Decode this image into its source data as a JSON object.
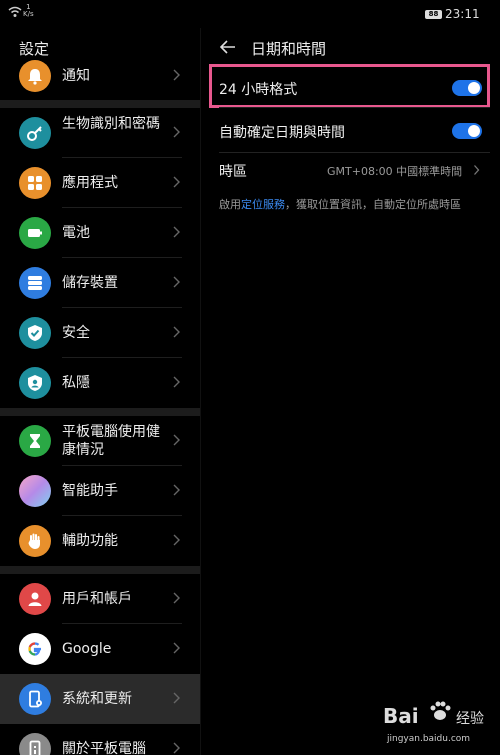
{
  "status_bar": {
    "speed_value": "1",
    "speed_unit": "K/s",
    "battery": "88",
    "time": "23:11"
  },
  "sidebar": {
    "title": "設定",
    "items": [
      {
        "label": "通知",
        "icon": "bell-icon",
        "color": "#e8902c"
      },
      {
        "label": "生物識別和密碼",
        "icon": "key-icon",
        "color": "#1e8f9e"
      },
      {
        "label": "應用程式",
        "icon": "apps-grid-icon",
        "color": "#e8902c"
      },
      {
        "label": "電池",
        "icon": "battery-icon",
        "color": "#2aa845"
      },
      {
        "label": "儲存裝置",
        "icon": "storage-icon",
        "color": "#2f7de0"
      },
      {
        "label": "安全",
        "icon": "shield-check-icon",
        "color": "#1e8f9e"
      },
      {
        "label": "私隱",
        "icon": "privacy-shield-icon",
        "color": "#1e8f9e"
      },
      {
        "label": "平板電腦使用健康情況",
        "icon": "hourglass-icon",
        "color": "#2aa845"
      },
      {
        "label": "智能助手",
        "icon": "assistant-orb-icon",
        "color": "#c48be0"
      },
      {
        "label": "輔助功能",
        "icon": "hand-icon",
        "color": "#e8902c"
      },
      {
        "label": "用戶和帳戶",
        "icon": "user-icon",
        "color": "#e04848"
      },
      {
        "label": "Google",
        "icon": "google-icon",
        "color": "#ffffff"
      },
      {
        "label": "系統和更新",
        "icon": "tablet-settings-icon",
        "color": "#2f7de0"
      },
      {
        "label": "關於平板電腦",
        "icon": "tablet-icon",
        "color": "#8a8a8a"
      }
    ]
  },
  "detail": {
    "title": "日期和時間",
    "hour24": {
      "label": "24 小時格式",
      "enabled": true
    },
    "auto": {
      "label": "自動確定日期與時間",
      "enabled": true
    },
    "timezone": {
      "label": "時區",
      "value": "GMT+08:00 中國標準時間"
    },
    "note_prefix": "啟用",
    "note_link": "定位服務",
    "note_suffix": "，獲取位置資訊，自動定位所處時區"
  },
  "watermark": {
    "brand": "Bai",
    "brand_suffix": "经验",
    "url": "jingyan.baidu.com"
  },
  "colors": {
    "accent": "#1e73e8",
    "highlight": "#e8588e",
    "link": "#3b8af0"
  }
}
